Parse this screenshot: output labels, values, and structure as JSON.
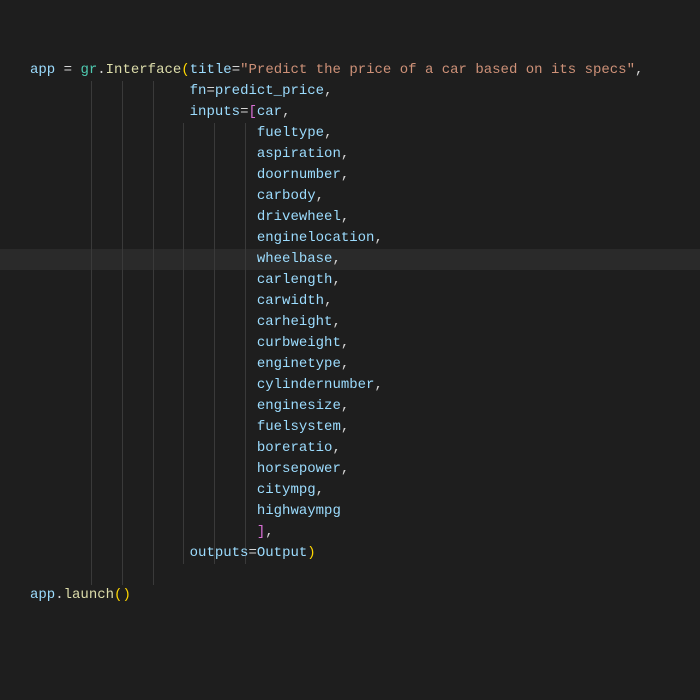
{
  "code": {
    "line1": {
      "var": "app",
      "eq": " = ",
      "module": "gr",
      "dot": ".",
      "func": "Interface",
      "open": "(",
      "param": "title",
      "assign": "=",
      "string": "\"Predict the price of a car based on its specs\"",
      "comma": ","
    },
    "line2": {
      "indent": "                   ",
      "param": "fn",
      "assign": "=",
      "val": "predict_price",
      "comma": ","
    },
    "line3": {
      "indent": "                   ",
      "param": "inputs",
      "assign": "=",
      "bracket": "[",
      "val": "car",
      "comma": ","
    },
    "inputs": [
      "fueltype",
      "aspiration",
      "doornumber",
      "carbody",
      "drivewheel",
      "enginelocation",
      "wheelbase",
      "carlength",
      "carwidth",
      "carheight",
      "curbweight",
      "enginetype",
      "cylindernumber",
      "enginesize",
      "fuelsystem",
      "boreratio",
      "horsepower",
      "citympg",
      "highwaympg"
    ],
    "input_indent": "                           ",
    "close_bracket_line": {
      "indent": "                           ",
      "bracket": "]",
      "comma": ","
    },
    "outputs_line": {
      "indent": "                   ",
      "param": "outputs",
      "assign": "=",
      "val": "Output",
      "close": ")"
    },
    "launch_line": {
      "var": "app",
      "dot": ".",
      "method": "launch",
      "parens": "()"
    },
    "comma": ","
  }
}
